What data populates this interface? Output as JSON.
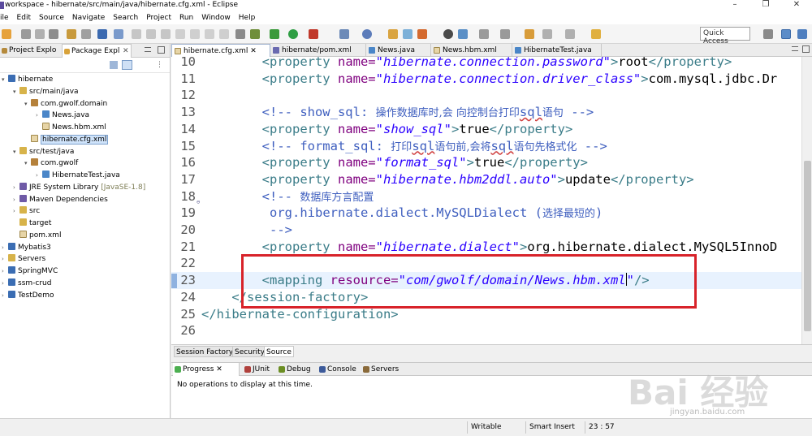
{
  "window": {
    "title": "workspace - hibernate/src/main/java/hibernate.cfg.xml - Eclipse",
    "controls": [
      "–",
      "❐",
      "✕"
    ]
  },
  "menu": [
    "ile",
    "Edit",
    "Source",
    "Navigate",
    "Search",
    "Project",
    "Run",
    "Window",
    "Help"
  ],
  "toolbar": {
    "quick_access": "Quick Access"
  },
  "left_panel": {
    "tabs": [
      "Project Explo",
      "Package Expl"
    ],
    "tree": [
      {
        "label": "hibernate",
        "depth": 0,
        "icon": "project-icon",
        "arrow": "▾"
      },
      {
        "label": "src/main/java",
        "depth": 1,
        "icon": "source-folder-icon",
        "arrow": "▾"
      },
      {
        "label": "com.gwolf.domain",
        "depth": 2,
        "icon": "package-icon",
        "arrow": "▾"
      },
      {
        "label": "News.java",
        "depth": 3,
        "icon": "java-file-icon",
        "arrow": "›"
      },
      {
        "label": "News.hbm.xml",
        "depth": 3,
        "icon": "xml-file-icon",
        "arrow": ""
      },
      {
        "label": "hibernate.cfg.xml",
        "depth": 2,
        "icon": "xml-file-icon",
        "arrow": "",
        "selected": true
      },
      {
        "label": "src/test/java",
        "depth": 1,
        "icon": "source-folder-icon",
        "arrow": "▾"
      },
      {
        "label": "com.gwolf",
        "depth": 2,
        "icon": "package-icon",
        "arrow": "▾"
      },
      {
        "label": "HibernateTest.java",
        "depth": 3,
        "icon": "java-file-icon",
        "arrow": "›"
      },
      {
        "label": "JRE System Library",
        "decor": "[JavaSE-1.8]",
        "depth": 1,
        "icon": "library-icon",
        "arrow": "›"
      },
      {
        "label": "Maven Dependencies",
        "depth": 1,
        "icon": "library-icon",
        "arrow": "›"
      },
      {
        "label": "src",
        "depth": 1,
        "icon": "folder-icon",
        "arrow": "›"
      },
      {
        "label": "target",
        "depth": 1,
        "icon": "folder-icon",
        "arrow": ""
      },
      {
        "label": "pom.xml",
        "depth": 1,
        "icon": "xml-file-icon",
        "arrow": ""
      },
      {
        "label": "Mybatis3",
        "depth": 0,
        "icon": "project-icon",
        "arrow": "›"
      },
      {
        "label": "Servers",
        "depth": 0,
        "icon": "folder-icon",
        "arrow": "›"
      },
      {
        "label": "SpringMVC",
        "depth": 0,
        "icon": "project-icon",
        "arrow": "›"
      },
      {
        "label": "ssm-crud",
        "depth": 0,
        "icon": "project-icon",
        "arrow": "›"
      },
      {
        "label": "TestDemo",
        "depth": 0,
        "icon": "project-icon",
        "arrow": "›"
      }
    ]
  },
  "editor": {
    "tabs": [
      {
        "label": "hibernate.cfg.xml ✕",
        "active": true,
        "icon": "xml-file-icon"
      },
      {
        "label": "hibernate/pom.xml",
        "icon": "xml-file-icon"
      },
      {
        "label": "News.java",
        "icon": "java-file-icon"
      },
      {
        "label": "News.hbm.xml",
        "icon": "xml-file-icon"
      },
      {
        "label": "HibernateTest.java",
        "icon": "java-file-icon"
      }
    ],
    "lines": [
      {
        "n": "10",
        "segs": [
          [
            "t",
            "        "
          ],
          [
            "tag",
            "<property "
          ],
          [
            "attr",
            "name="
          ],
          [
            "val",
            "\"hibernate.connection.password\""
          ],
          [
            "tag",
            ">"
          ],
          [
            "txt",
            "root"
          ],
          [
            "tag",
            "</property>"
          ]
        ]
      },
      {
        "n": "11",
        "segs": [
          [
            "t",
            "        "
          ],
          [
            "tag",
            "<property "
          ],
          [
            "attr",
            "name="
          ],
          [
            "val",
            "\"hibernate.connection.driver_class\""
          ],
          [
            "tag",
            ">"
          ],
          [
            "txt",
            "com.mysql.jdbc.Dr"
          ]
        ]
      },
      {
        "n": "12",
        "segs": []
      },
      {
        "n": "13",
        "segs": [
          [
            "t",
            "        "
          ],
          [
            "cmt",
            "<!-- show_sql: "
          ],
          [
            "cjk",
            "操作数据库时,会 向控制台打印"
          ],
          [
            "sq",
            "sql"
          ],
          [
            "cjk",
            "语句"
          ],
          [
            "cmt",
            " -->"
          ]
        ]
      },
      {
        "n": "14",
        "segs": [
          [
            "t",
            "        "
          ],
          [
            "tag",
            "<property "
          ],
          [
            "attr",
            "name="
          ],
          [
            "val",
            "\"show_sql\""
          ],
          [
            "tag",
            ">"
          ],
          [
            "txt",
            "true"
          ],
          [
            "tag",
            "</property>"
          ]
        ]
      },
      {
        "n": "15",
        "segs": [
          [
            "t",
            "        "
          ],
          [
            "cmt",
            "<!-- format_sql: "
          ],
          [
            "cjk",
            "打印"
          ],
          [
            "sq",
            "sql"
          ],
          [
            "cjk",
            "语句前,会将"
          ],
          [
            "sq",
            "sql"
          ],
          [
            "cjk",
            "语句先格式化"
          ],
          [
            "cmt",
            " -->"
          ]
        ]
      },
      {
        "n": "16",
        "segs": [
          [
            "t",
            "        "
          ],
          [
            "tag",
            "<property "
          ],
          [
            "attr",
            "name="
          ],
          [
            "val",
            "\"format_sql\""
          ],
          [
            "tag",
            ">"
          ],
          [
            "txt",
            "true"
          ],
          [
            "tag",
            "</property>"
          ]
        ]
      },
      {
        "n": "17",
        "segs": [
          [
            "t",
            "        "
          ],
          [
            "tag",
            "<property "
          ],
          [
            "attr",
            "name="
          ],
          [
            "val",
            "\"hibernate.hbm2ddl.auto\""
          ],
          [
            "tag",
            ">"
          ],
          [
            "txt",
            "update"
          ],
          [
            "tag",
            "</property>"
          ]
        ]
      },
      {
        "n": "18",
        "fold": "⊖",
        "segs": [
          [
            "t",
            "        "
          ],
          [
            "cmt",
            "<!-- "
          ],
          [
            "cjk",
            "数据库方言配置"
          ]
        ]
      },
      {
        "n": "19",
        "segs": [
          [
            "t",
            "         "
          ],
          [
            "cmt",
            "org.hibernate.dialect.MySQLDialect ("
          ],
          [
            "cjk",
            "选择最短的"
          ],
          [
            "cmt",
            ")"
          ]
        ]
      },
      {
        "n": "20",
        "segs": [
          [
            "t",
            "         "
          ],
          [
            "cmt",
            "-->"
          ]
        ]
      },
      {
        "n": "21",
        "segs": [
          [
            "t",
            "        "
          ],
          [
            "tag",
            "<property "
          ],
          [
            "attr",
            "name="
          ],
          [
            "val",
            "\"hibernate.dialect\""
          ],
          [
            "tag",
            ">"
          ],
          [
            "txt",
            "org.hibernate.dialect.MySQL5InnoD"
          ]
        ]
      },
      {
        "n": "22",
        "segs": []
      },
      {
        "n": "23",
        "current": true,
        "segs": [
          [
            "t",
            "        "
          ],
          [
            "tag",
            "<mapping "
          ],
          [
            "attr",
            "resource="
          ],
          [
            "val",
            "\"com/gwolf/domain/News.hbm.xml"
          ],
          [
            "cursor",
            ""
          ],
          [
            "val",
            "\""
          ],
          [
            "tag",
            "/>"
          ]
        ]
      },
      {
        "n": "24",
        "segs": [
          [
            "t",
            "    "
          ],
          [
            "tag",
            "</session-factory>"
          ]
        ]
      },
      {
        "n": "25",
        "segs": [
          [
            "tag",
            "</hibernate-configuration>"
          ]
        ]
      },
      {
        "n": "26",
        "segs": []
      }
    ],
    "bottom_tabs": [
      "Session Factory",
      "Security",
      "Source"
    ]
  },
  "progress_view": {
    "tabs": [
      {
        "label": "Progress ✕",
        "icon": "progress-icon",
        "color": "#4caf50"
      },
      {
        "label": "JUnit",
        "icon": "junit-icon",
        "color": "#b0403c"
      },
      {
        "label": "Debug",
        "icon": "debug-icon",
        "color": "#6b8e23"
      },
      {
        "label": "Console",
        "icon": "console-icon",
        "color": "#3c5a9a"
      },
      {
        "label": "Servers",
        "icon": "servers-icon",
        "color": "#8a6a3a"
      }
    ],
    "message": "No operations to display at this time."
  },
  "watermark": {
    "main": "Bai 经验",
    "sub": "jingyan.baidu.com"
  },
  "status_bar": {
    "writable": "Writable",
    "insert_mode": "Smart Insert",
    "position": "23 : 57"
  },
  "colors": {
    "highlight_box": "#d8232a",
    "tag": "#3a7c88",
    "attribute": "#7f007f",
    "value": "#2a00ff",
    "comment": "#3f5fbf"
  }
}
